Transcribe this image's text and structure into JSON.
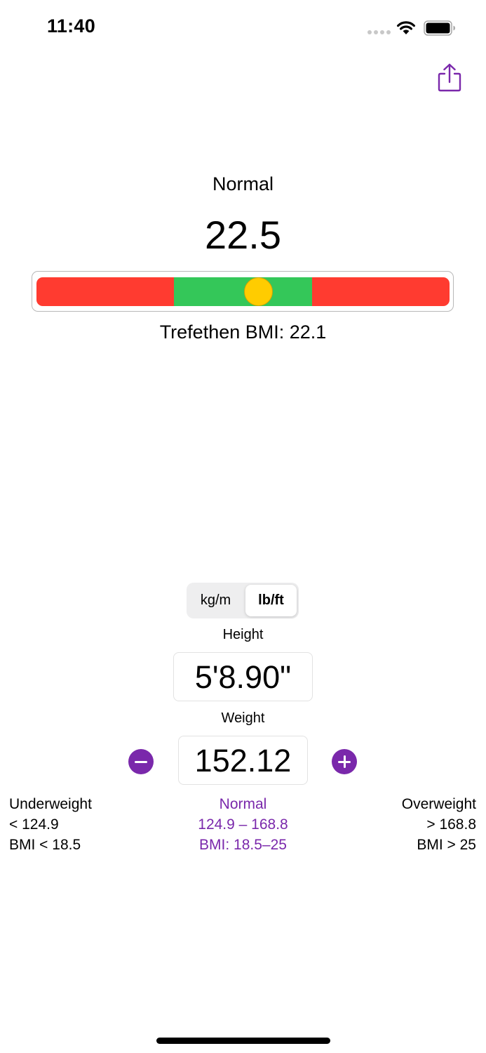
{
  "status_bar": {
    "time": "11:40"
  },
  "result": {
    "category": "Normal",
    "bmi": "22.5",
    "trefethen": "Trefethen BMI: 22.1",
    "marker_position_fraction": 0.537
  },
  "gauge": {
    "segments": [
      {
        "color": "#ff3b30",
        "fraction": 0.333
      },
      {
        "color": "#34c759",
        "fraction": 0.334
      },
      {
        "color": "#ff3b30",
        "fraction": 0.333
      }
    ],
    "marker_color": "#ffcc00"
  },
  "units": {
    "options": [
      "kg/m",
      "lb/ft"
    ],
    "selected": "lb/ft"
  },
  "height": {
    "label": "Height",
    "value": "5'8.90\""
  },
  "weight": {
    "label": "Weight",
    "value": "152.12"
  },
  "ranges": {
    "underweight": {
      "title": "Underweight",
      "range": "< 124.9",
      "bmi": "BMI < 18.5"
    },
    "normal": {
      "title": "Normal",
      "range": "124.9 – 168.8",
      "bmi": "BMI: 18.5–25"
    },
    "overweight": {
      "title": "Overweight",
      "range": "> 168.8",
      "bmi": "BMI > 25"
    }
  },
  "colors": {
    "accent": "#7a28ab",
    "red": "#ff3b30",
    "green": "#34c759",
    "yellow": "#ffcc00"
  },
  "icons": {
    "share": "share-icon",
    "minus": "minus-icon",
    "plus": "plus-icon",
    "wifi": "wifi-icon",
    "battery": "battery-icon"
  }
}
